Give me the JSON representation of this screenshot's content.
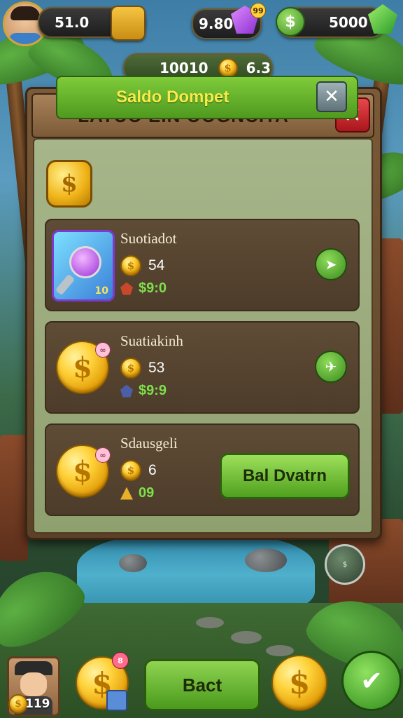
{
  "hud": {
    "coins_value": "51.0",
    "gems_value": "9.80",
    "gem_badge": "99",
    "cash_value": "5000",
    "sub_value_left": "10010",
    "sub_value_right": "6.3"
  },
  "modal": {
    "title": "LATUO  EIN OOGNCITA",
    "close_icon": "close-icon",
    "balance_label": "Saldo Dompet"
  },
  "items": [
    {
      "title": "Suotiadot",
      "price": "54",
      "sub": "$9:0",
      "thumb_num": "10",
      "action_icon": "arrow-right-icon"
    },
    {
      "title": "Suatiakinh",
      "price": "53",
      "sub": "$9:9",
      "action_icon": "plane-icon"
    },
    {
      "title": "Sdausgeli",
      "price": "6",
      "sub": "09",
      "buy_label": "Bal Dvatrn"
    }
  ],
  "bottom": {
    "level": "119",
    "back_label": "Bact",
    "coin_badge": "8"
  },
  "colors": {
    "accent_green": "#4fa01f",
    "close_red": "#d1272b",
    "gold": "#ffd23a"
  }
}
